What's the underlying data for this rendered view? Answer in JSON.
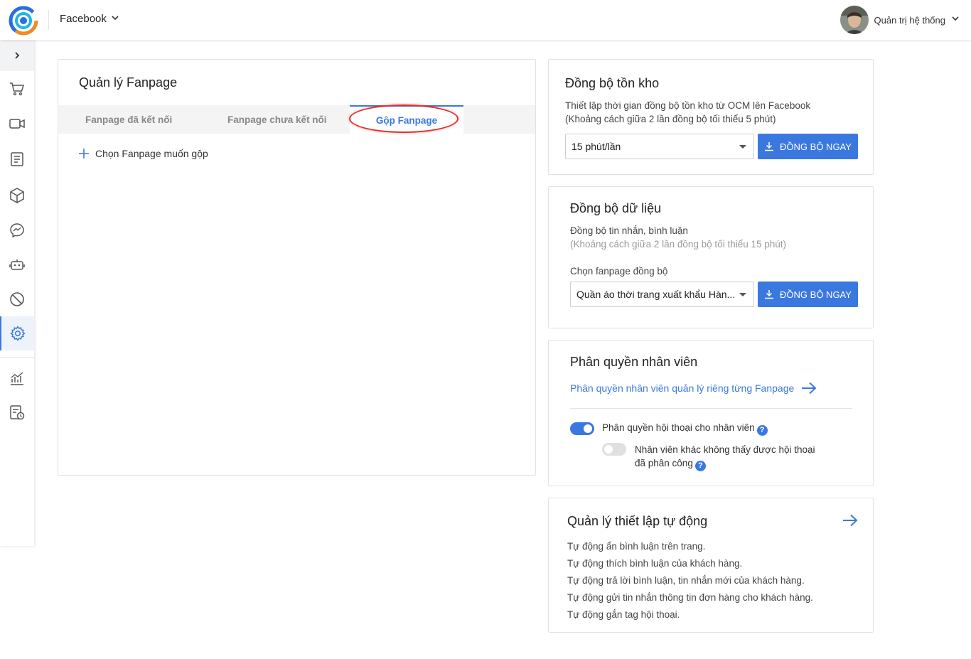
{
  "header": {
    "app_name": "Facebook",
    "user_name": "Quản trị hệ thống",
    "accent": "#3a78e0"
  },
  "sidebar": {
    "items": [
      {
        "icon": "cart-icon"
      },
      {
        "icon": "video-icon"
      },
      {
        "icon": "document-icon"
      },
      {
        "icon": "box-icon"
      },
      {
        "icon": "messenger-icon"
      },
      {
        "icon": "robot-icon"
      },
      {
        "icon": "ban-icon"
      },
      {
        "icon": "gear-icon",
        "active": true
      },
      {
        "icon": "chart-icon"
      },
      {
        "icon": "report-icon"
      }
    ]
  },
  "fanpage_manager": {
    "title": "Quản lý Fanpage",
    "tabs": [
      {
        "label": "Fanpage đã kết nối"
      },
      {
        "label": "Fanpage chưa kết nối"
      },
      {
        "label": "Gộp Fanpage",
        "active": true
      }
    ],
    "add_label": "Chọn Fanpage muốn gộp"
  },
  "inventory_sync": {
    "title": "Đồng bộ tồn kho",
    "desc_line1": "Thiết lập thời gian đồng bộ tồn kho từ OCM lên Facebook",
    "desc_line2": "(Khoảng cách giữa 2 lần đồng bộ tối thiểu 5 phút)",
    "interval_value": "15 phút/lần",
    "button": "ĐỒNG BỘ NGAY"
  },
  "data_sync": {
    "title": "Đồng bộ dữ liệu",
    "desc_line1": "Đồng bộ tin nhắn, bình luận",
    "desc_line2": "(Khoảng cách giữa 2 lần đồng bộ tối thiểu 15 phút)",
    "select_label": "Chọn fanpage đồng bộ",
    "fanpage_value": "Quần áo thời trang xuất khẩu Hàn...",
    "button": "ĐỒNG BỘ NGAY"
  },
  "staff_permission": {
    "title": "Phân quyền nhân viên",
    "link": "Phân quyền nhân viên quản lý riêng từng Fanpage",
    "toggle1_label": "Phân quyền hội thoại cho nhân viên",
    "toggle1_on": true,
    "toggle2_line1": "Nhân viên khác không thấy được hội thoại",
    "toggle2_line2": "đã phân công",
    "toggle2_on": false,
    "help": "?"
  },
  "auto_settings": {
    "title": "Quản lý thiết lập tự động",
    "items": [
      "Tự động ẩn bình luận trên trang.",
      "Tự động thích bình luận của khách hàng.",
      "Tự động trả lời bình luận, tin nhắn mới của khách hàng.",
      "Tự động gửi tin nhắn thông tin đơn hàng cho khách hàng.",
      "Tự động gắn tag hội thoại."
    ]
  }
}
